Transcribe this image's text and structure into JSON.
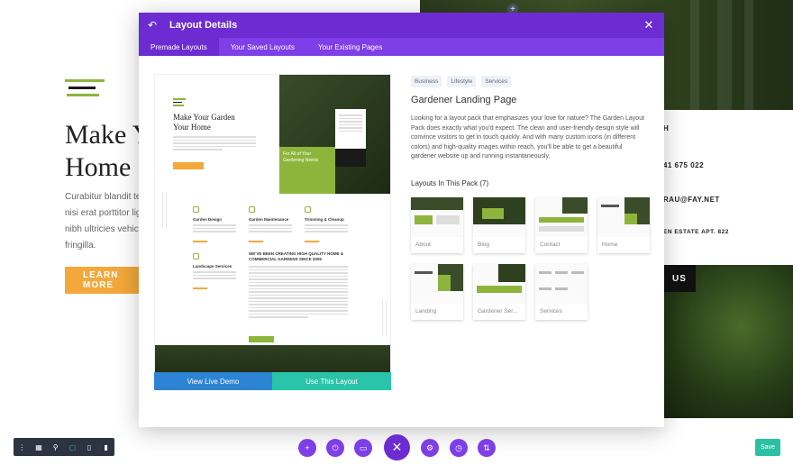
{
  "background": {
    "title_lines": [
      "Make Y",
      "Home"
    ],
    "body_lines": [
      "Curabitur blandit te",
      "nisi erat porttitor lig",
      "nibh ultricies vehicu",
      "fringilla."
    ],
    "cta_label": "LEARN MORE",
    "contact_lines": [
      "H",
      "41 675 022",
      "RAU@FAY.NET",
      "EN ESTATE APT. 822"
    ],
    "contact_button": "US"
  },
  "modal": {
    "header_title": "Layout Details",
    "back_icon": "back-arrow-icon",
    "close_icon": "close-icon",
    "tabs": [
      {
        "label": "Premade Layouts",
        "active": true
      },
      {
        "label": "Your Saved Layouts",
        "active": false
      },
      {
        "label": "Your Existing Pages",
        "active": false
      }
    ],
    "preview": {
      "heading_lines": [
        "Make Your Garden",
        "Your Home"
      ],
      "green_block_text": "For All of Your Gardening Needs",
      "services": [
        "Garden Design",
        "Garden Maintenance",
        "Trimming & Cleanup",
        "Landscape Services"
      ],
      "section_heading": "WE'VE BEEN CREATING HIGH QUALITY HOME & COMMERCIAL GARDENS SINCE 2009"
    },
    "buttons": {
      "live_demo": "View Live Demo",
      "use_layout": "Use This Layout"
    },
    "tags": [
      "Business",
      "Lifestyle",
      "Services"
    ],
    "layout_title": "Gardener Landing Page",
    "description": "Looking for a layout pack that emphasizes your love for nature? The Garden Layout Pack does exactly what you'd expect. The clean and user-friendly design style will convince visitors to get in touch quickly. And with many custom icons (in different colors) and high-quality images within reach, you'll be able to get a beautiful gardener website up and running instantaneously.",
    "pack_title": "Layouts In This Pack (7)",
    "layouts": [
      "About",
      "Blog",
      "Contact",
      "Home",
      "Landing",
      "Gardener Ser...",
      "Services"
    ]
  },
  "toolbar": {
    "left_icons": [
      "menu-dots-icon",
      "wireframe-icon",
      "zoom-icon",
      "desktop-icon",
      "tablet-icon",
      "phone-icon"
    ],
    "center_icons": [
      "add-icon",
      "power-icon",
      "trash-icon",
      "close-icon",
      "settings-icon",
      "history-icon",
      "sort-icon"
    ],
    "save_label": "Save"
  },
  "colors": {
    "purple_header": "#6d2cd1",
    "purple_tabs": "#7e3ee8",
    "blue_button": "#2d84d4",
    "teal_button": "#29c4a9",
    "garden_green": "#8db53c",
    "accent_orange": "#f2a83b"
  }
}
